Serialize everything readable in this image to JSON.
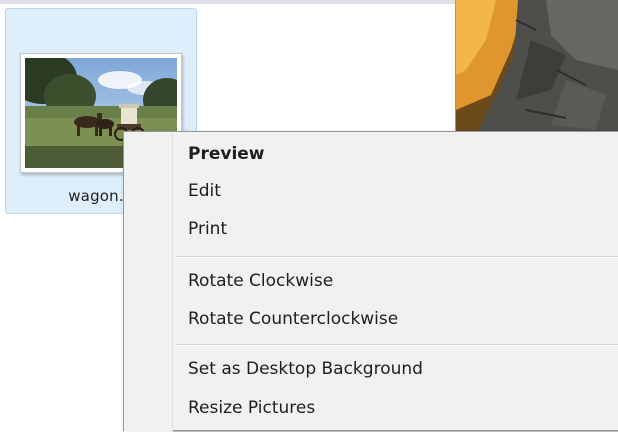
{
  "file_tile": {
    "filename": "wagon..."
  },
  "context_menu": {
    "items": [
      {
        "label": "Preview",
        "default": true
      },
      {
        "label": "Edit"
      },
      {
        "label": "Print"
      },
      {
        "label": "Rotate Clockwise"
      },
      {
        "label": "Rotate Counterclockwise"
      },
      {
        "label": "Set as Desktop Background"
      },
      {
        "label": "Resize Pictures"
      }
    ]
  },
  "colors": {
    "selection_background": "#dfeefb",
    "selection_border": "#b7d6f1",
    "menu_background": "#f1f1f1",
    "menu_border": "#979797"
  }
}
